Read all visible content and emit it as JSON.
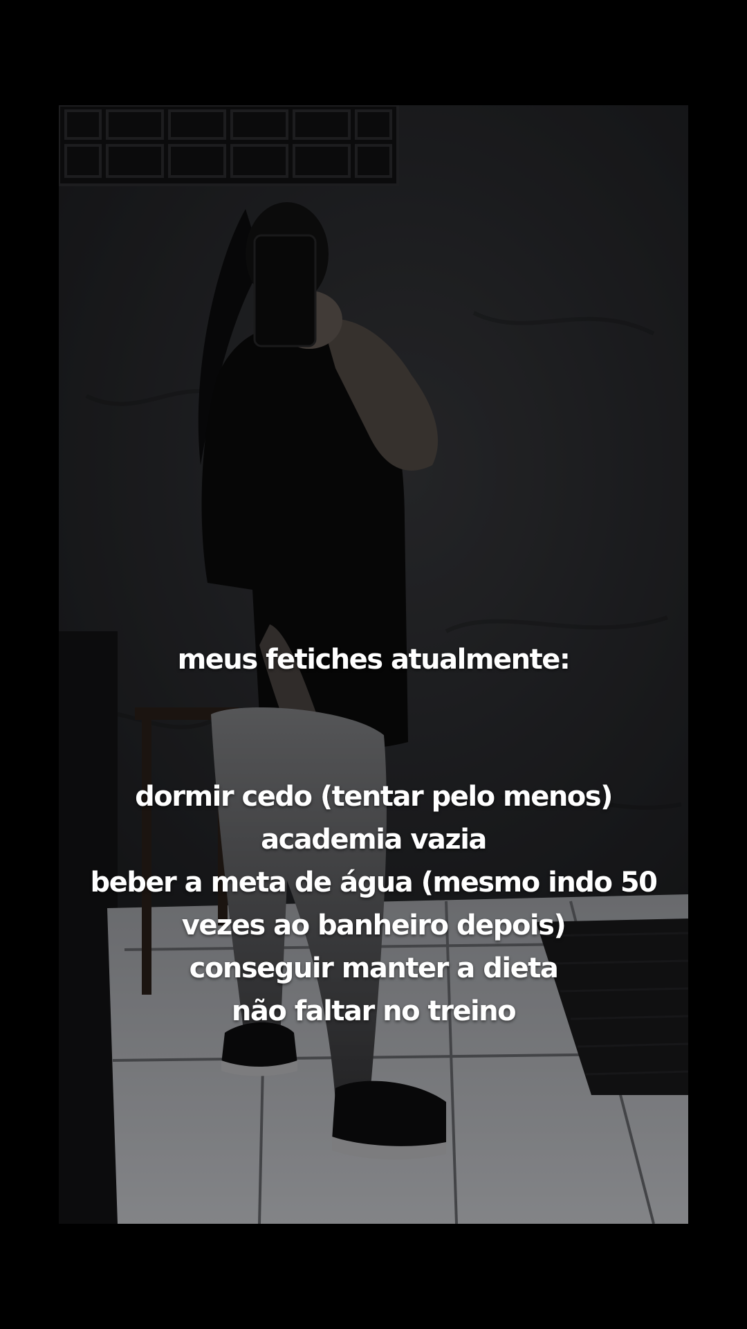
{
  "story": {
    "heading": "meus fetiches atualmente:",
    "lines": [
      "dormir cedo (tentar pelo menos)",
      "academia vazia",
      "beber a meta de água (mesmo indo 50",
      "vezes ao banheiro depois)",
      "conseguir manter a dieta",
      "não faltar no treino"
    ]
  },
  "colors": {
    "letterbox": "#000000",
    "wall": "#2a2b2e",
    "floor": "#c9cbd0",
    "text": "#ffffff"
  }
}
